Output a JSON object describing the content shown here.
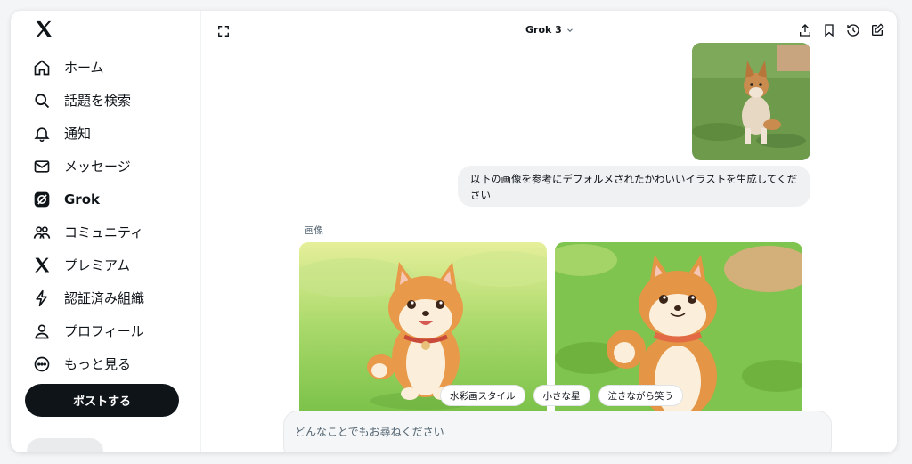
{
  "sidebar": {
    "items": [
      {
        "label": "ホーム",
        "icon": "home-icon"
      },
      {
        "label": "話題を検索",
        "icon": "search-icon"
      },
      {
        "label": "通知",
        "icon": "bell-icon"
      },
      {
        "label": "メッセージ",
        "icon": "mail-icon"
      },
      {
        "label": "Grok",
        "icon": "grok-icon",
        "active": true
      },
      {
        "label": "コミュニティ",
        "icon": "community-icon"
      },
      {
        "label": "プレミアム",
        "icon": "x-premium-icon"
      },
      {
        "label": "認証済み組織",
        "icon": "lightning-icon"
      },
      {
        "label": "プロフィール",
        "icon": "person-icon"
      },
      {
        "label": "もっと見る",
        "icon": "more-circle-icon"
      }
    ],
    "post_label": "ポストする"
  },
  "header": {
    "model": "Grok 3"
  },
  "chat": {
    "user_message": "以下の画像を参考にデフォルメされたかわいいイラストを生成してください",
    "images_label": "画像",
    "suggestions": [
      "水彩画スタイル",
      "小さな星",
      "泣きながら笑う"
    ]
  },
  "composer": {
    "placeholder": "どんなことでもお尋ねください"
  },
  "colors": {
    "text": "#0f1419",
    "muted": "#536471",
    "accent": "#0f1419",
    "bubble": "#eff1f3"
  }
}
